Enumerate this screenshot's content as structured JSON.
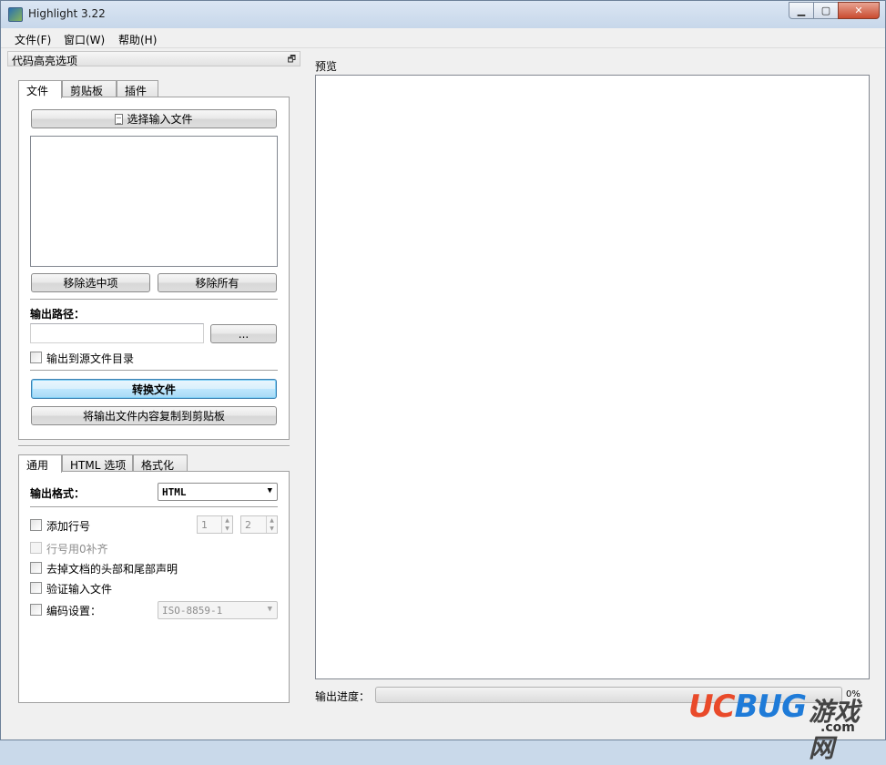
{
  "window": {
    "title": "Highlight 3.22",
    "controls": {
      "minimize": "▁",
      "maximize": "▢",
      "close": "✕"
    }
  },
  "menu": [
    "文件(F)",
    "窗口(W)",
    "帮助(H)"
  ],
  "dock": {
    "title": "代码高亮选项",
    "float_glyph": "🗗"
  },
  "top_tabs": [
    "文件",
    "剪贴板",
    "插件"
  ],
  "file_tab": {
    "select_button": "选择输入文件",
    "remove_selected": "移除选中项",
    "remove_all": "移除所有",
    "output_path_label": "输出路径：",
    "output_path_value": "",
    "browse_button": "...",
    "output_to_source": "输出到源文件目录",
    "convert_button": "转换文件",
    "copy_button": "将输出文件内容复制到剪贴板"
  },
  "bottom_tabs": [
    "通用",
    "HTML 选项",
    "格式化"
  ],
  "general_tab": {
    "output_format_label": "输出格式：",
    "output_format_value": "HTML",
    "add_line_numbers": "添加行号",
    "line_start": "1",
    "line_width": "2",
    "pad_zero": "行号用0补齐",
    "remove_header": "去掉文档的头部和尾部声明",
    "validate_input": "验证输入文件",
    "encoding_label": "编码设置：",
    "encoding_value": "ISO-8859-1"
  },
  "preview": {
    "label": "预览"
  },
  "progress": {
    "label": "输出进度：",
    "value_percent": 0,
    "text": "0%"
  },
  "watermark": {
    "brand_a": "UC",
    "brand_b": "BUG",
    "cn": "游戏网",
    "domain": ".com"
  }
}
